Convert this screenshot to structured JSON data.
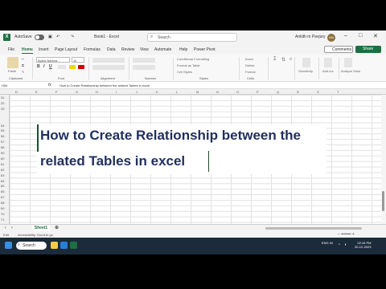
{
  "titlebar": {
    "autosave": "AutoSave",
    "book_title": "Book1 - Excel",
    "search_placeholder": "Search",
    "user_name": "Ankith m Pavjury",
    "avatar_initials": "AM"
  },
  "tabs": [
    "File",
    "Home",
    "Insert",
    "Page Layout",
    "Formulas",
    "Data",
    "Review",
    "View",
    "Automate",
    "Help",
    "Power Pivot"
  ],
  "actions": {
    "comments": "Comments",
    "share": "Share"
  },
  "ribbon": {
    "paste": "Paste",
    "font_name": "Aptos Narrow",
    "font_size": "11",
    "cond_format": "Conditional Formatting",
    "format_table": "Format as Table",
    "cell_styles": "Cell Styles",
    "insert": "Insert",
    "delete": "Delete",
    "format": "Format",
    "sensitivity": "Sensitivity",
    "addins": "Add-ins",
    "analyze": "Analyze Data",
    "groups": [
      "Clipboard",
      "Font",
      "Alignment",
      "Number",
      "Styles",
      "Cells",
      "Editing",
      "Sensitivity",
      "Add-ins"
    ]
  },
  "formula_bar": {
    "name_box": "H54",
    "fx": "fx",
    "value": "How to Create Relationship between the related Tables in excel"
  },
  "columns": [
    "D",
    "E",
    "F",
    "G",
    "H",
    "I",
    "J",
    "K",
    "L",
    "M",
    "N",
    "O",
    "P",
    "Q",
    "R",
    "S",
    "T"
  ],
  "rows": [
    "31",
    "32",
    "33",
    "",
    "",
    "54",
    "55",
    "56",
    "57",
    "58",
    "59",
    "60",
    "61",
    "62",
    "63",
    "64",
    "65",
    "66",
    "67",
    "68",
    "69",
    "70",
    "71",
    "72",
    "73",
    "74",
    "75"
  ],
  "overlay": {
    "line1": "How to Create Relationship between the",
    "line2": "related  Tables in excel"
  },
  "sheet_tab": "Sheet1",
  "status": {
    "ready": "Edit",
    "accessibility": "Accessibility: Good to go"
  },
  "taskbar": {
    "search": "Search",
    "lang": "ENG IN",
    "time": "02:16 PM",
    "date": "20-12-2023"
  },
  "colors": {
    "excel_green": "#1d6f42",
    "title_text": "#1f2f5e",
    "taskbar": "#1c2b3a"
  }
}
